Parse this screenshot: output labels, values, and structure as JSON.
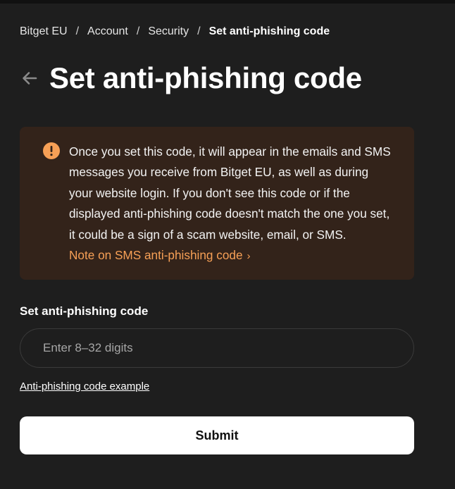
{
  "breadcrumb": {
    "items": [
      "Bitget EU",
      "Account",
      "Security"
    ],
    "current": "Set anti-phishing code",
    "separator": "/"
  },
  "page": {
    "title": "Set anti-phishing code",
    "back_icon": "arrow-left-icon"
  },
  "notice": {
    "icon": "exclamation-circle-icon",
    "icon_color": "#F7A056",
    "background": "#33231A",
    "text": "Once you set this code, it will appear in the emails and SMS messages you receive from Bitget EU, as well as during your website login. If you don't see this code or if the displayed anti-phishing code doesn't match the one you set, it could be a sign of a scam website, email, or SMS.",
    "link_text": "Note on SMS anti-phishing code",
    "link_icon": "chevron-right-icon",
    "link_color": "#F7A056"
  },
  "form": {
    "label": "Set anti-phishing code",
    "placeholder": "Enter 8–32 digits",
    "value": "",
    "example_link": "Anti-phishing code example",
    "submit_label": "Submit"
  }
}
